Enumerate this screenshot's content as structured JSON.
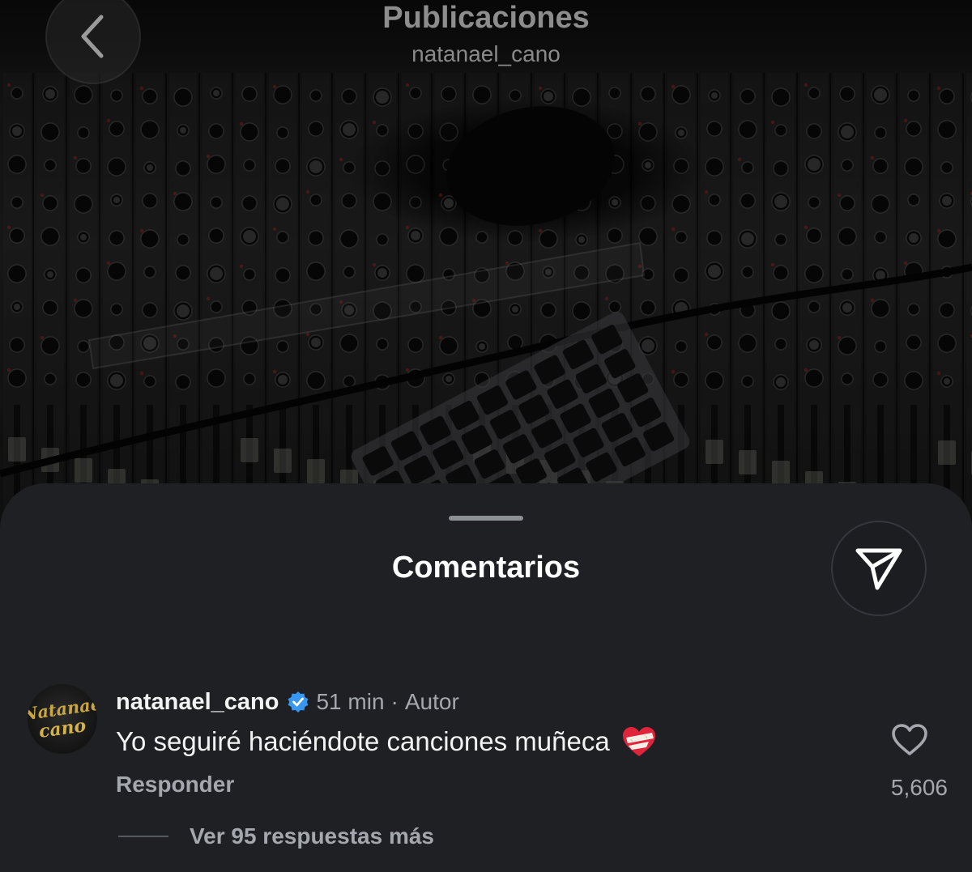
{
  "header": {
    "title": "Publicaciones",
    "subtitle": "natanael_cano",
    "back_icon": "chevron-left-icon"
  },
  "background_photo": {
    "description_icon": "mixing-console-photo"
  },
  "comments_sheet": {
    "title": "Comentarios",
    "share_icon": "send-icon",
    "comments": [
      {
        "avatar_logo_text": "Natanael Cano",
        "username": "natanael_cano",
        "verified": true,
        "verified_color": "#3897f0",
        "timestamp": "51 min",
        "separator": "·",
        "author_tag": "Autor",
        "text": "Yo seguiré haciéndote canciones muñeca",
        "emoji": "mending-heart-emoji",
        "reply_label": "Responder",
        "like_icon": "heart-outline-icon",
        "like_count": "5,606",
        "view_replies_label": "Ver 95 respuestas más"
      }
    ]
  },
  "colors": {
    "sheet_background": "#1e2024",
    "secondary_text": "#a4a7ad",
    "primary_text": "#f2f2f2"
  }
}
